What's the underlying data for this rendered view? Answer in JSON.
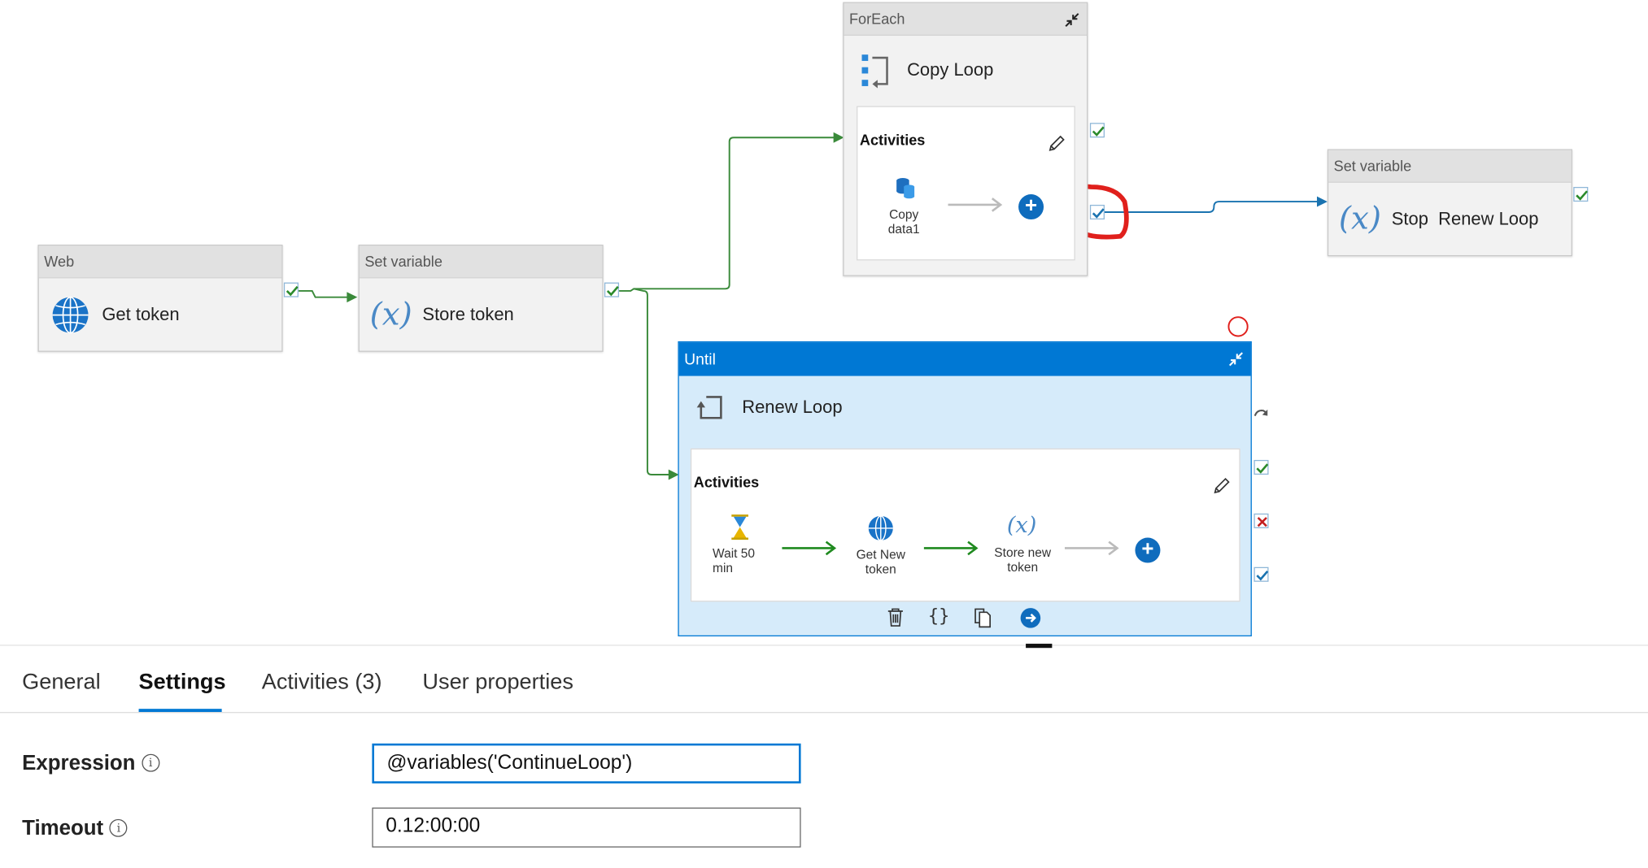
{
  "nodes": {
    "web": {
      "type": "Web",
      "title": "Get token"
    },
    "store": {
      "type": "Set variable",
      "title": "Store token"
    },
    "foreach": {
      "type": "ForEach",
      "title": "Copy Loop",
      "activities_label": "Activities",
      "child": "Copy\ndata1"
    },
    "stop": {
      "type": "Set variable",
      "title": "Stop  Renew Loop"
    },
    "until": {
      "type": "Until",
      "title": "Renew Loop",
      "activities_label": "Activities",
      "children": [
        "Wait 50\nmin",
        "Get New\ntoken",
        "Store new\ntoken"
      ]
    }
  },
  "tabs": [
    "General",
    "Settings",
    "Activities (3)",
    "User properties"
  ],
  "active_tab": "Settings",
  "settings": {
    "expression_label": "Expression",
    "expression_value": "@variables('ContinueLoop')",
    "timeout_label": "Timeout",
    "timeout_value": "0.12:00:00",
    "info_glyph": "i"
  },
  "colors": {
    "success_line": "#3a8a3a",
    "completion_line": "#1a73b0",
    "until_header": "#0078d4",
    "until_body": "#d6ebfa",
    "annotation_red": "#e0201c",
    "tab_accent": "#0078d4"
  }
}
